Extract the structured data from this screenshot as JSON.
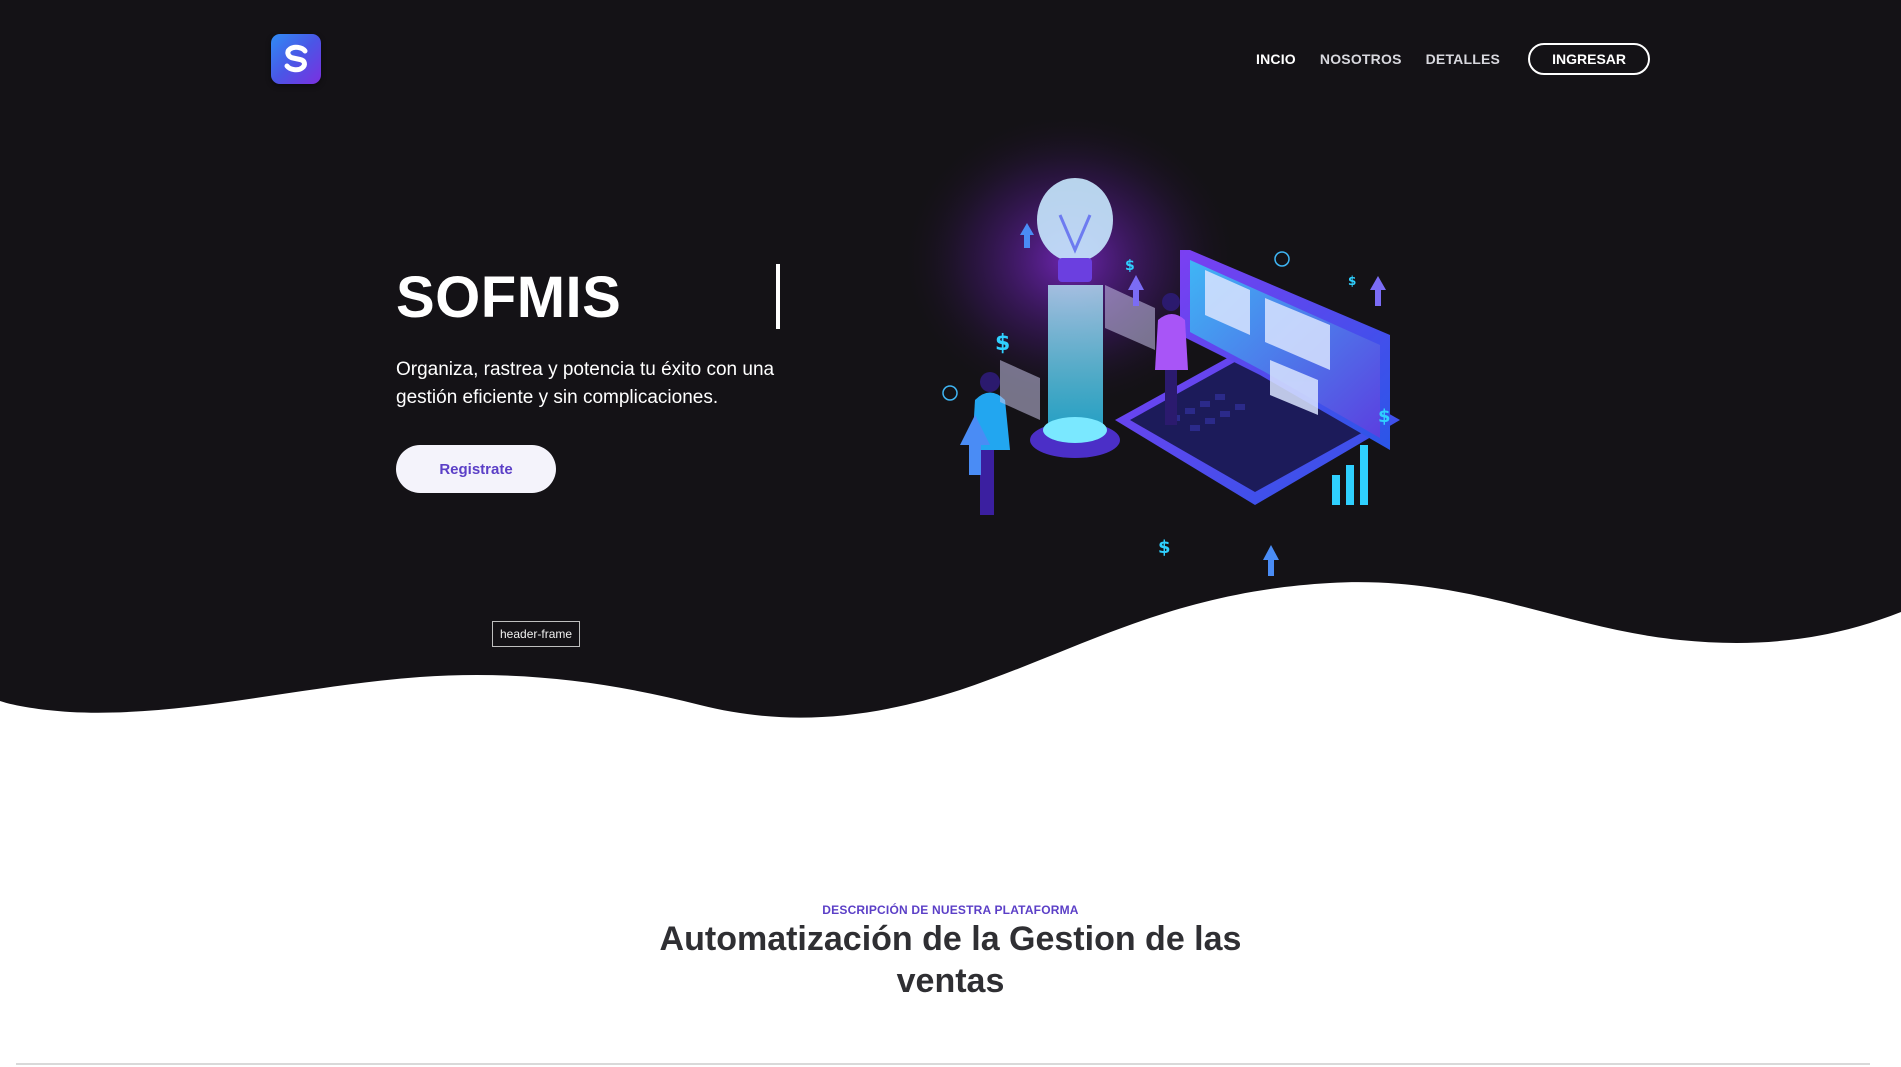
{
  "colors": {
    "hero_background": "#141216",
    "accent": "#5b3fc7",
    "page_background": "#ffffff",
    "title_dark": "#2f2f33"
  },
  "brand": {
    "logo_letter": "S",
    "logo_icon": "sofmis-logo-icon"
  },
  "nav": {
    "items": [
      {
        "label": "INCIO",
        "active": true
      },
      {
        "label": "NOSOTROS",
        "active": false
      },
      {
        "label": "DETALLES",
        "active": false
      }
    ],
    "login_label": "INGRESAR"
  },
  "hero": {
    "title": "SOFMIS",
    "subtitle": "Organiza, rastrea y potencia tu éxito con una gestión eficiente y sin complicaciones.",
    "cta_label": "Registrate",
    "frame_label": "header-frame",
    "illustration_icon": "analytics-lightbulb-laptop-illustration"
  },
  "section": {
    "eyebrow": "DESCRIPCIÓN DE NUESTRA PLATAFORMA",
    "title": "Automatización de la Gestion de las ventas"
  }
}
